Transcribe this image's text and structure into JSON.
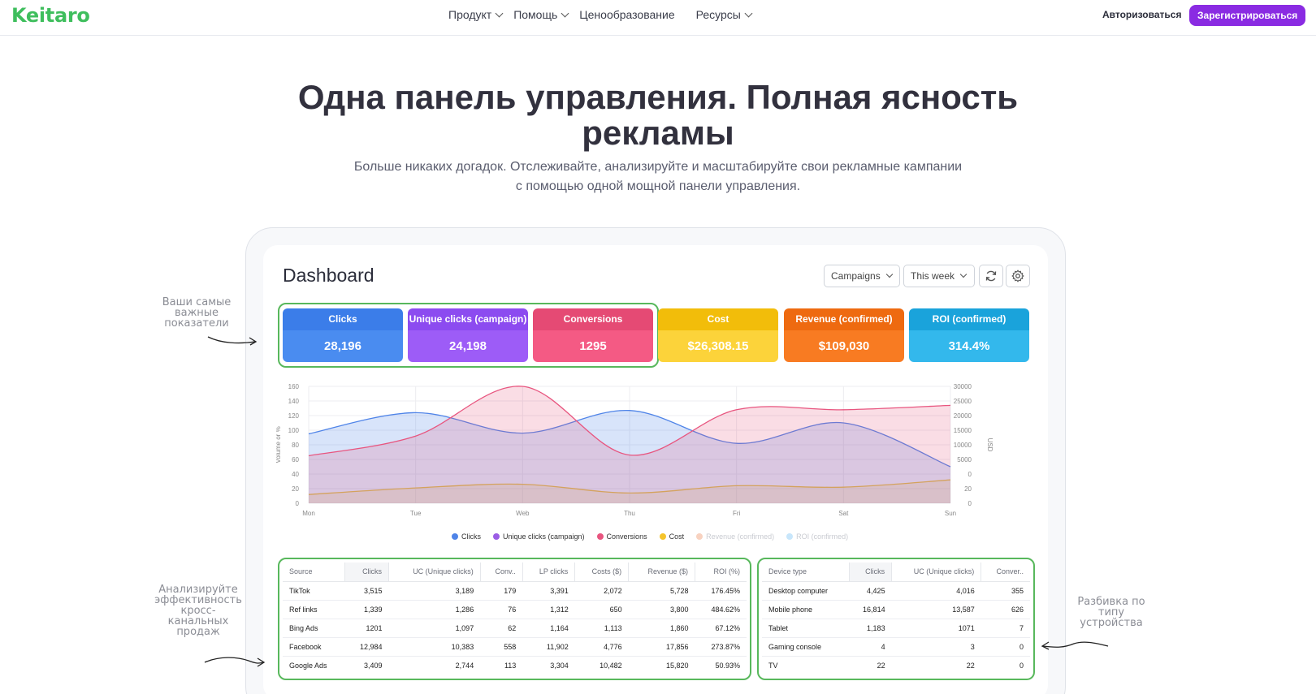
{
  "nav": {
    "logo": "Keitaro",
    "items": [
      {
        "label": "Продукт",
        "dropdown": true
      },
      {
        "label": "Помощь",
        "dropdown": true
      },
      {
        "label": "Ценообразование",
        "dropdown": false
      },
      {
        "label": "Ресурсы",
        "dropdown": true
      }
    ],
    "login": "Авторизоваться",
    "signup": "Зарегистрироваться"
  },
  "hero": {
    "title_line1": "Одна панель управления. Полная ясность",
    "title_line2": "рекламы",
    "sub_line1": "Больше никаких догадок. Отслеживайте, анализируйте и масштабируйте свои рекламные кампании",
    "sub_line2": "с помощью одной мощной панели управления."
  },
  "notes": {
    "left_top": [
      "Ваши самые",
      "важные",
      "показатели"
    ],
    "left_bottom": [
      "Анализируйте",
      "эффективность",
      "кросс-",
      "канальных",
      "продаж"
    ],
    "right_bottom": [
      "Разбивка по",
      "типу",
      "устройства"
    ]
  },
  "dashboard": {
    "title": "Dashboard",
    "campaigns_select": "Campaigns",
    "period_select": "This week",
    "kpis": [
      {
        "label": "Clicks",
        "value": "28,196",
        "head": "#3b7de9",
        "body": "#4a8cf0"
      },
      {
        "label": "Unique clicks (campaign)",
        "value": "24,198",
        "head": "#8c4bf0",
        "body": "#9d5cf7"
      },
      {
        "label": "Conversions",
        "value": "1295",
        "head": "#e54a74",
        "body": "#f45a84"
      },
      {
        "label": "Cost",
        "value": "$26,308.15",
        "head": "#f2bd0a",
        "body": "#fcd33a"
      },
      {
        "label": "Revenue (confirmed)",
        "value": "$109,030",
        "head": "#ee6a10",
        "body": "#f87b22"
      },
      {
        "label": "ROI (confirmed)",
        "value": "314.4%",
        "head": "#1aa3db",
        "body": "#33b8ec"
      }
    ]
  },
  "chart_data": {
    "type": "area",
    "title": "",
    "categories": [
      "Mon",
      "Tue",
      "Web",
      "Thu",
      "Fri",
      "Sat",
      "Sun"
    ],
    "ylabel": "Volume or %",
    "ylabel_right": "USD",
    "y_ticks": [
      "160",
      "140",
      "120",
      "100",
      "80",
      "60",
      "40",
      "20",
      "0"
    ],
    "y_right_ticks": [
      "30000",
      "25000",
      "20000",
      "15000",
      "10000",
      "5000",
      "0",
      "20",
      "0"
    ],
    "ylim": [
      0,
      160
    ],
    "grid": true,
    "legend_position": "bottom",
    "series": [
      {
        "name": "Clicks",
        "color": "#4f84e8",
        "values": [
          95,
          124,
          96,
          127,
          82,
          110,
          50
        ]
      },
      {
        "name": "Unique clicks (campaign)",
        "color": "#9b5de5",
        "values": [
          65,
          92,
          160,
          66,
          128,
          128,
          134
        ]
      },
      {
        "name": "Conversions",
        "color": "#e8557f",
        "values": [
          65,
          92,
          160,
          66,
          128,
          128,
          134
        ]
      },
      {
        "name": "Cost",
        "color": "#f5c42c",
        "values": [
          12,
          21,
          26,
          14,
          24,
          22,
          32
        ]
      },
      {
        "name": "Revenue (confirmed)",
        "color": "#f8d2c0",
        "values": [],
        "muted": true
      },
      {
        "name": "ROI (confirmed)",
        "color": "#c8e6fb",
        "values": [],
        "muted": true
      }
    ]
  },
  "sources_table": {
    "headers": [
      "Source",
      "Clicks",
      "UC (Unique clicks)",
      "Conv..",
      "LP clicks",
      "Costs ($)",
      "Revenue ($)",
      "ROI (%)"
    ],
    "rows": [
      [
        "TikTok",
        "3,515",
        "3,189",
        "179",
        "3,391",
        "2,072",
        "5,728",
        "176.45%"
      ],
      [
        "Ref links",
        "1,339",
        "1,286",
        "76",
        "1,312",
        "650",
        "3,800",
        "484.62%"
      ],
      [
        "Bing Ads",
        "1201",
        "1,097",
        "62",
        "1,164",
        "1,113",
        "1,860",
        "67.12%"
      ],
      [
        "Facebook",
        "12,984",
        "10,383",
        "558",
        "11,902",
        "4,776",
        "17,856",
        "273.87%"
      ],
      [
        "Google Ads",
        "3,409",
        "2,744",
        "113",
        "3,304",
        "10,482",
        "15,820",
        "50.93%"
      ]
    ]
  },
  "devices_table": {
    "headers": [
      "Device type",
      "Clicks",
      "UC (Unique clicks)",
      "Conver.."
    ],
    "rows": [
      [
        "Desktop computer",
        "4,425",
        "4,016",
        "355"
      ],
      [
        "Mobile phone",
        "16,814",
        "13,587",
        "626"
      ],
      [
        "Tablet",
        "1,183",
        "1071",
        "7"
      ],
      [
        "Gaming console",
        "4",
        "3",
        "0"
      ],
      [
        "TV",
        "22",
        "22",
        "0"
      ]
    ]
  }
}
